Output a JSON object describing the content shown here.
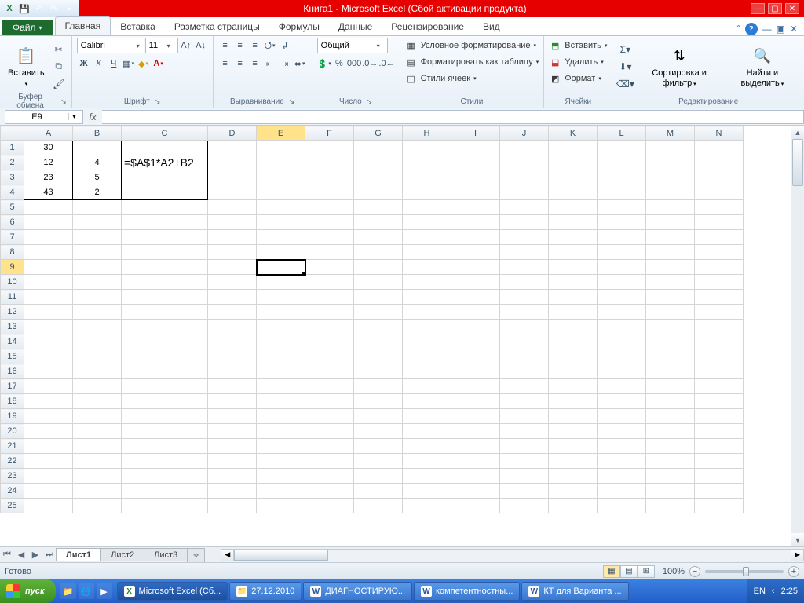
{
  "title": "Книга1  -  Microsoft Excel (Сбой активации продукта)",
  "tabs": {
    "file": "Файл",
    "home": "Главная",
    "insert": "Вставка",
    "layout": "Разметка страницы",
    "formulas": "Формулы",
    "data": "Данные",
    "review": "Рецензирование",
    "view": "Вид"
  },
  "ribbon": {
    "clipboard": {
      "paste": "Вставить",
      "label": "Буфер обмена"
    },
    "font": {
      "name": "Calibri",
      "size": "11",
      "label": "Шрифт"
    },
    "align": {
      "label": "Выравнивание"
    },
    "number": {
      "format": "Общий",
      "label": "Число"
    },
    "styles": {
      "cond": "Условное форматирование",
      "table": "Форматировать как таблицу",
      "cell": "Стили ячеек",
      "label": "Стили"
    },
    "cells": {
      "insert": "Вставить",
      "delete": "Удалить",
      "format": "Формат",
      "label": "Ячейки"
    },
    "editing": {
      "sort": "Сортировка и фильтр",
      "find": "Найти и выделить",
      "label": "Редактирование"
    }
  },
  "namebox": "E9",
  "formula": "",
  "columns": [
    "A",
    "B",
    "C",
    "D",
    "E",
    "F",
    "G",
    "H",
    "I",
    "J",
    "K",
    "L",
    "M",
    "N"
  ],
  "selected_col": "E",
  "selected_row": 9,
  "row_count": 25,
  "cells": {
    "A1": "30",
    "A2": "12",
    "B2": "4",
    "C2": "=$A$1*A2+B2",
    "A3": "23",
    "B3": "5",
    "A4": "43",
    "B4": "2"
  },
  "bordered_range": {
    "r1": 1,
    "r2": 4,
    "c1": "A",
    "c2": "C"
  },
  "sheets": {
    "active": "Лист1",
    "others": [
      "Лист2",
      "Лист3"
    ]
  },
  "status": {
    "ready": "Готово",
    "zoom": "100%"
  },
  "taskbar": {
    "start": "пуск",
    "items": [
      {
        "label": "Microsoft Excel (Сб...",
        "icon": "excel",
        "active": true
      },
      {
        "label": "27.12.2010",
        "icon": "folder",
        "active": false
      },
      {
        "label": "ДИАГНОСТИРУЮ...",
        "icon": "word",
        "active": false
      },
      {
        "label": "компетентностны...",
        "icon": "word",
        "active": false
      },
      {
        "label": "КТ для Варианта ...",
        "icon": "word",
        "active": false
      }
    ],
    "lang": "EN",
    "time": "2:25"
  }
}
